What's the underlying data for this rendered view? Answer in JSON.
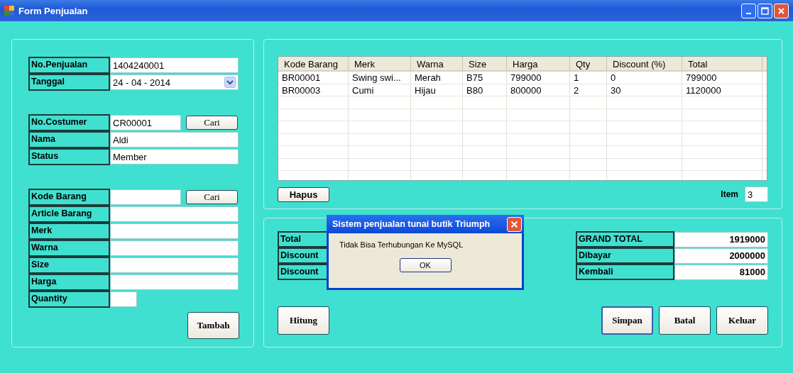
{
  "window": {
    "title": "Form Penjualan"
  },
  "groups": [
    {
      "rows": [
        {
          "label": "No.Penjualan",
          "value": "1404240001",
          "kind": "text"
        },
        {
          "label": "Tanggal",
          "value": "24 - 04 - 2014",
          "kind": "date"
        }
      ]
    },
    {
      "rows": [
        {
          "label": "No.Costumer",
          "value": "CR00001",
          "kind": "search",
          "button": "Cari"
        },
        {
          "label": "Nama",
          "value": "Aldi",
          "kind": "text"
        },
        {
          "label": "Status",
          "value": "Member",
          "kind": "text"
        }
      ]
    },
    {
      "rows": [
        {
          "label": "Kode Barang",
          "value": "",
          "kind": "search",
          "button": "Cari"
        },
        {
          "label": "Article Barang",
          "value": "",
          "kind": "text"
        },
        {
          "label": "Merk",
          "value": "",
          "kind": "text"
        },
        {
          "label": "Warna",
          "value": "",
          "kind": "text"
        },
        {
          "label": "Size",
          "value": "",
          "kind": "text"
        },
        {
          "label": "Harga",
          "value": "",
          "kind": "text"
        },
        {
          "label": "Quantity",
          "value": "",
          "kind": "short"
        }
      ]
    }
  ],
  "add_button": "Tambah",
  "table": {
    "columns": [
      "Kode Barang",
      "Merk",
      "Warna",
      "Size",
      "Harga",
      "Qty",
      "Discount (%)",
      "Total"
    ],
    "rows": [
      [
        "BR00001",
        "Swing swi...",
        "Merah",
        "B75",
        "799000",
        "1",
        "0",
        "799000"
      ],
      [
        "BR00003",
        "Cumi",
        "Hijau",
        "B80",
        "800000",
        "2",
        "30",
        "1120000"
      ]
    ]
  },
  "delete_button": "Hapus",
  "item": {
    "label": "Item",
    "value": "3"
  },
  "totals_labels": [
    "Total",
    "Discount",
    "Discount"
  ],
  "summary": [
    {
      "label": "GRAND TOTAL",
      "value": "1919000"
    },
    {
      "label": "Dibayar",
      "value": "2000000"
    },
    {
      "label": "Kembali",
      "value": "81000"
    }
  ],
  "calc_button": "Hitung",
  "actions": [
    {
      "label": "Simpan",
      "selected": true
    },
    {
      "label": "Batal",
      "selected": false
    },
    {
      "label": "Keluar",
      "selected": false
    }
  ],
  "dialog": {
    "title": "Sistem penjualan tunai butik Triumph",
    "message": "Tidak Bisa Terhubungan Ke MySQL",
    "button": "OK"
  }
}
